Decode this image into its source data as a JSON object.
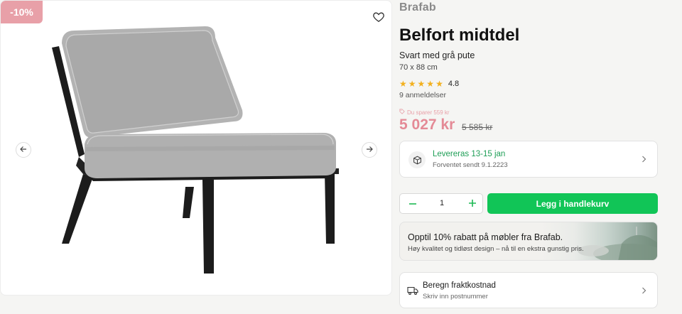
{
  "gallery": {
    "discount_badge": "-10%",
    "icons": {
      "favorite": "heart-icon",
      "prev": "arrow-left-icon",
      "next": "arrow-right-icon"
    }
  },
  "product": {
    "brand": "Brafab",
    "title": "Belfort midtdel",
    "subtitle": "Svart med grå pute",
    "dimensions": "70 x 88 cm",
    "rating": "4.8",
    "stars": 5,
    "reviews": "9 anmeldelser",
    "savings": "Du sparer 559 kr",
    "price": "5 027 kr",
    "old_price": "5 585 kr"
  },
  "delivery": {
    "title": "Levereras 13-15 jan",
    "subtitle": "Forventet sendt 9.1.2223",
    "icon": "package-icon"
  },
  "cart": {
    "quantity": "1",
    "add_label": "Legg i handlekurv"
  },
  "promo": {
    "title": "Opptil 10% rabatt på møbler fra Brafab.",
    "subtitle": "Høy kvalitet og tidløst design – nå til en ekstra gunstig pris."
  },
  "freight": {
    "title": "Beregn fraktkostnad",
    "subtitle": "Skriv inn postnummer",
    "icon": "truck-icon"
  },
  "colors": {
    "accent_green": "#11c557",
    "sale_pink": "#e48a96",
    "badge_pink": "#e8a0a8",
    "delivery_green": "#1e9e56",
    "star": "#f2b01e"
  }
}
